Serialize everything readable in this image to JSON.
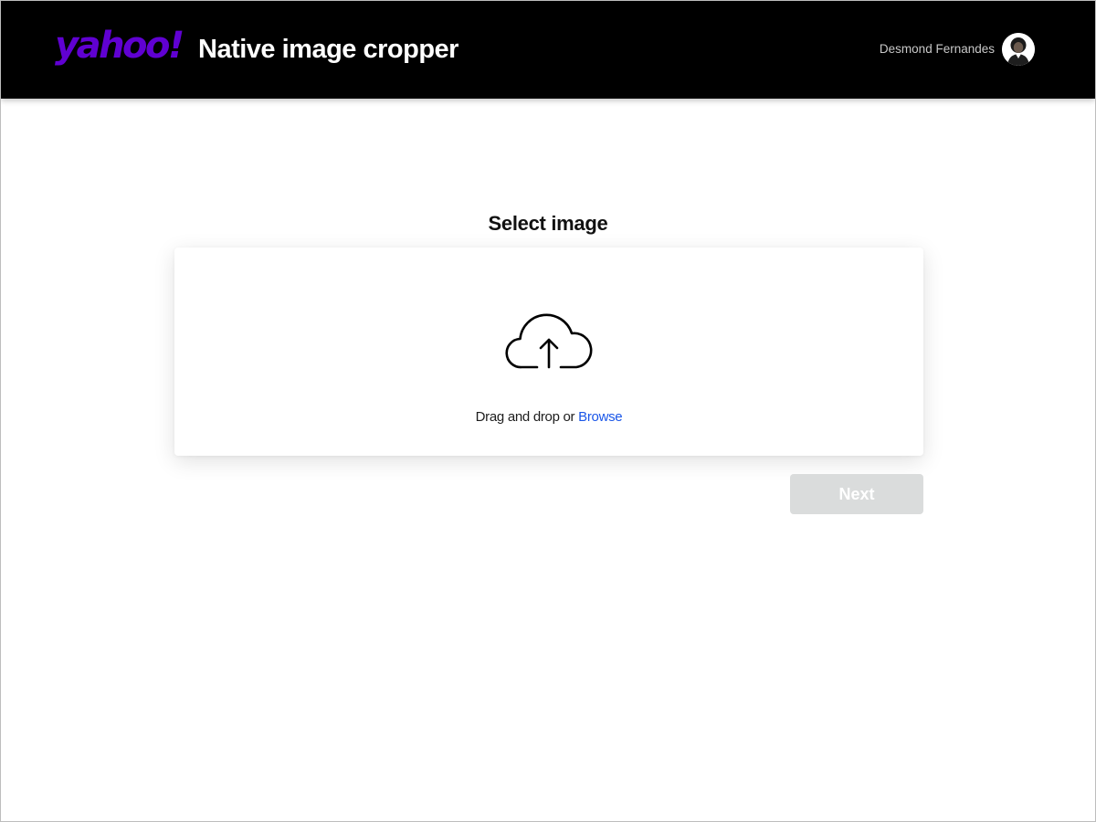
{
  "header": {
    "logo_text": "yahoo!",
    "logo_color": "#6001d2",
    "app_title": "Native image cropper",
    "background": "#000000"
  },
  "user": {
    "name": "Desmond Fernandes",
    "avatar_icon": "user-avatar"
  },
  "main": {
    "section_title": "Select image",
    "upload_icon": "cloud-upload-icon",
    "drop_text": "Drag and drop or",
    "browse_label": "Browse",
    "link_color": "#1a56e8"
  },
  "actions": {
    "next_label": "Next",
    "next_disabled": true
  }
}
